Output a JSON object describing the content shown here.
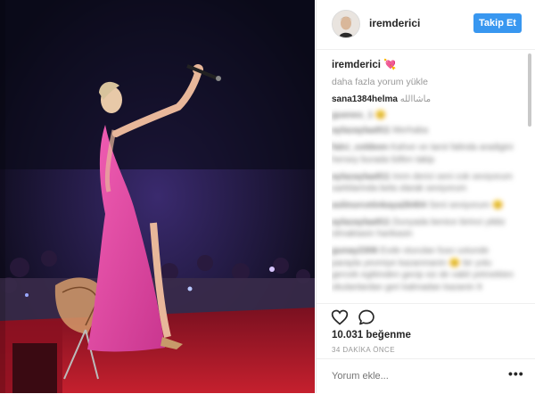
{
  "post": {
    "username": "iremderici",
    "follow_label": "Takip Et",
    "caption_user": "iremderici",
    "caption_emoji": "💘",
    "load_more": "daha fazla yorum yükle",
    "comments": [
      {
        "user": "sana1384helma",
        "text": "ماشاالله",
        "blurred": false
      },
      {
        "user": "guenes_1",
        "text": "😊",
        "blurred": true
      },
      {
        "user": "aylazaylaa911",
        "text": "Merhaba",
        "blurred": true
      },
      {
        "user": "falci_coldeen",
        "text": "Kahve ve tarot falinda aradigini hersey burada lütfen takip",
        "blurred": true
      },
      {
        "user": "aylazaylaa911",
        "text": "Irem derici seni cok seviyorum sarkilarinda bela olarak seviyorum",
        "blurred": true
      },
      {
        "user": "aslinurcetinkaya26404",
        "text": "Seni seviyorum 😊",
        "blurred": true
      },
      {
        "user": "aylazaylaa911",
        "text": "Dunyada benice birinci yildiz olmaktasin harikasin",
        "blurred": true
      },
      {
        "user": "gunay2306",
        "text": "Evde oturulan fuso ustunde parayla yevmiye kazanmanin 😊 bir yolu gercek egitimden gecip siz de vakit yetmekten okulanlardan geri kalmadan kazanin 9",
        "blurred": true
      }
    ],
    "likes": "10.031 beğenme",
    "time_ago": "34 DAKİKA ÖNCE",
    "comment_placeholder": "Yorum ekle...",
    "more_options": "•••",
    "icons": {
      "like": "heart-icon",
      "comment": "comment-icon"
    }
  }
}
